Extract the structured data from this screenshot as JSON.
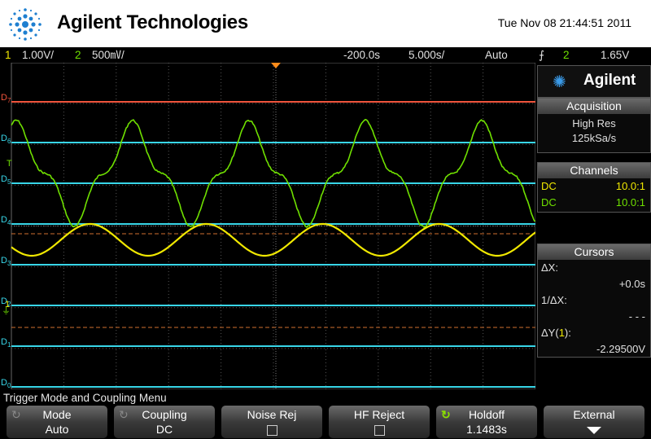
{
  "header": {
    "brand": "Agilent Technologies",
    "datetime": "Tue Nov 08 21:44:51 2011"
  },
  "status": {
    "ch1_num": "1",
    "ch1_scale": "1.00V/",
    "ch2_num": "2",
    "ch2_scale": "500㎷/",
    "delay": "-200.0s",
    "timebase": "5.000s/",
    "trigger_mode": "Auto",
    "trigger_symbol": "⨍",
    "trigger_source": "2",
    "trigger_level": "1.65V"
  },
  "digital_labels": [
    "D7",
    "D6",
    "D5",
    "D4",
    "D3",
    "D2",
    "D1",
    "D0"
  ],
  "ground_markers": {
    "t": "T",
    "ch1": "1"
  },
  "panel": {
    "brand": "Agilent",
    "acquisition": {
      "title": "Acquisition",
      "mode": "High Res",
      "rate": "125kSa/s"
    },
    "channels": {
      "title": "Channels",
      "rows": [
        {
          "coupling": "DC",
          "probe": "10.0:1",
          "color": "#f0e800"
        },
        {
          "coupling": "DC",
          "probe": "10.0:1",
          "color": "#6fe000"
        }
      ]
    },
    "cursors": {
      "title": "Cursors",
      "dx_label": "ΔX:",
      "dx_value": "+0.0s",
      "inv_dx_label": "1/ΔX:",
      "inv_dx_value": "- - -",
      "dy_label": "ΔY(",
      "dy_ch": "1",
      "dy_close": "):",
      "dy_value": "-2.29500V"
    }
  },
  "menu": {
    "title": "Trigger Mode and Coupling Menu",
    "softkeys": [
      {
        "label": "Mode",
        "value": "Auto"
      },
      {
        "label": "Coupling",
        "value": "DC"
      },
      {
        "label": "Noise Rej",
        "value": ""
      },
      {
        "label": "HF Reject",
        "value": ""
      },
      {
        "label": "Holdoff",
        "value": "1.1483s"
      },
      {
        "label": "External",
        "value": ""
      }
    ]
  },
  "colors": {
    "ch1": "#f0e800",
    "ch2": "#6fe000",
    "digital": "#38d6e8",
    "d7": "#f0543c",
    "grid": "#555555"
  }
}
